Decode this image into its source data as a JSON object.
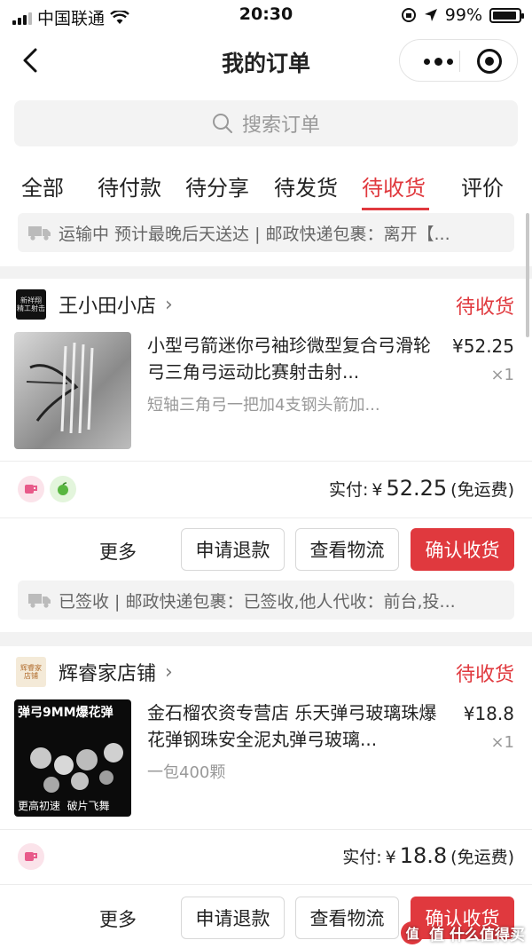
{
  "status_bar": {
    "carrier": "中国联通",
    "time": "20:30",
    "battery": "99%"
  },
  "nav": {
    "title": "我的订单"
  },
  "search": {
    "placeholder": "搜索订单"
  },
  "tabs": [
    {
      "label": "全部"
    },
    {
      "label": "待付款"
    },
    {
      "label": "待分享"
    },
    {
      "label": "待发货"
    },
    {
      "label": "待收货",
      "active": true
    },
    {
      "label": "评价"
    }
  ],
  "orders": [
    {
      "notice": "运输中 预计最晚后天送达 | 邮政快递包裹：离开【...",
      "shop_name": "王小田小店",
      "shop_logo_text": "新祥翔 精工射击",
      "status": "待收货",
      "product_title": "小型弓箭迷你弓袖珍微型复合弓滑轮弓三角弓运动比赛射击射...",
      "product_spec": "短轴三角弓一把加4支钢头箭加...",
      "price": "¥52.25",
      "qty": "×1",
      "paid_label": "实付:",
      "paid_currency": "¥",
      "paid_amount": "52.25",
      "shipping_note": "(免运费)",
      "more_label": "更多",
      "refund_label": "申请退款",
      "logistics_label": "查看物流",
      "confirm_label": "确认收货"
    },
    {
      "notice": "已签收 | 邮政快递包裹：已签收,他人代收：前台,投...",
      "shop_name": "辉睿家店铺",
      "shop_logo_text": "辉睿家 店铺",
      "status": "待收货",
      "product_title": "金石榴农资专营店 乐天弹弓玻璃珠爆花弹钢珠安全泥丸弹弓玻璃...",
      "product_spec": "一包400颗",
      "thumb_top_text": "弹弓9MM爆花弹",
      "thumb_bottom_text": "更高初速  破片飞舞",
      "price": "¥18.8",
      "qty": "×1",
      "paid_label": "实付:",
      "paid_currency": "¥",
      "paid_amount": "18.8",
      "shipping_note": "(免运费)",
      "more_label": "更多",
      "refund_label": "申请退款",
      "logistics_label": "查看物流",
      "confirm_label": "确认收货"
    }
  ],
  "watermark": {
    "text": "值 什么值得买"
  },
  "colors": {
    "accent": "#e0393e",
    "background": "#f2f2f2"
  }
}
